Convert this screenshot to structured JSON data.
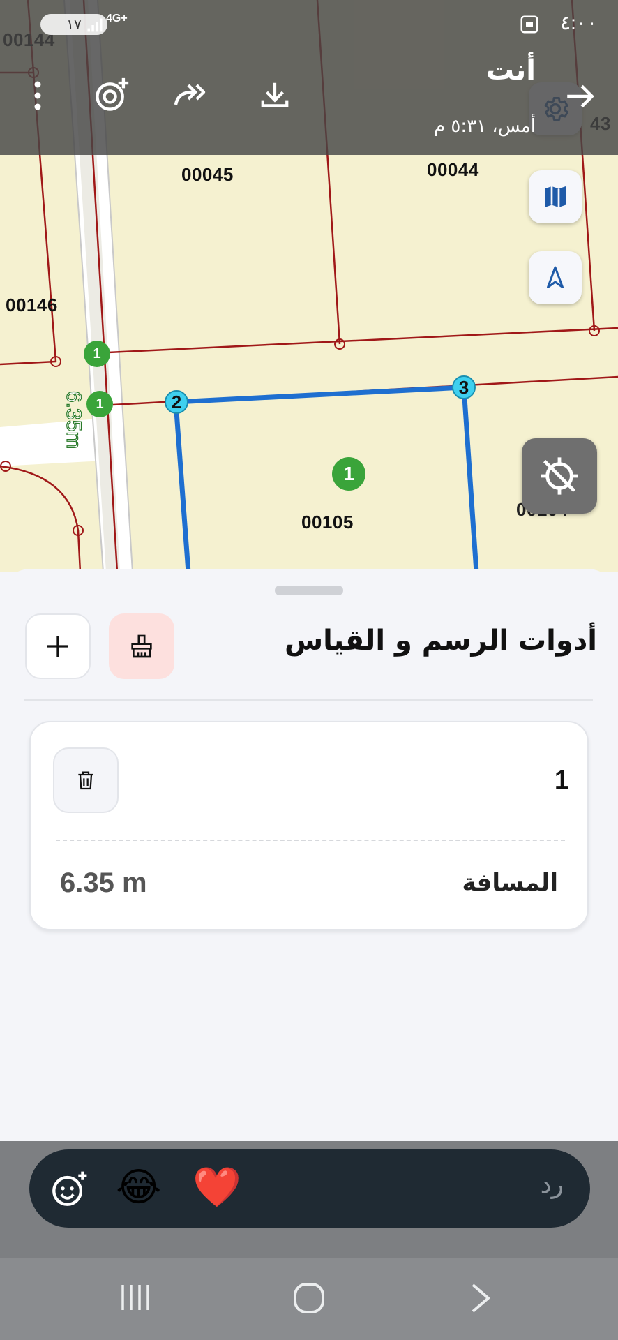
{
  "status_bar": {
    "time": "٤:٠٠",
    "network": "4G+",
    "battery": "١٧"
  },
  "story_header": {
    "sender": "أنت",
    "timestamp": "أمس، ٥:٣١ م"
  },
  "map": {
    "lot_labels": [
      "00144",
      "00045",
      "00044",
      "00146",
      "00105",
      "43",
      "00104"
    ],
    "point_labels": [
      "2",
      "3"
    ],
    "marker_label": "1",
    "small_markers": [
      "1",
      "1"
    ],
    "segment_length": "6.35m",
    "line_color": "#1e6fd0",
    "parcel_line_color": "#a01818"
  },
  "sheet": {
    "title": "أدوات الرسم و القياس",
    "measurement": {
      "id": "1",
      "distance_label": "المسافة",
      "distance_value": "6.35 m"
    }
  },
  "reply": {
    "placeholder": "رد",
    "emojis": [
      "😂",
      "❤️"
    ]
  },
  "colors": {
    "brush_button_bg": "#fde0de",
    "accent_blue": "#1e6fd0",
    "marker_green": "#3aa43a"
  }
}
